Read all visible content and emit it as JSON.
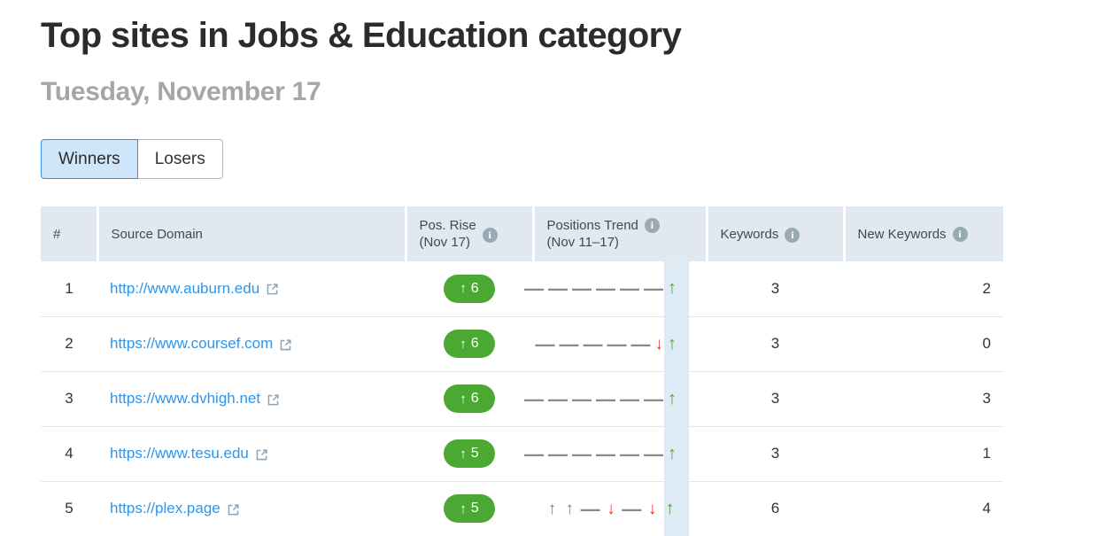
{
  "header": {
    "title": "Top sites in Jobs & Education category",
    "subtitle": "Tuesday, November 17"
  },
  "tabs": [
    {
      "label": "Winners",
      "active": true
    },
    {
      "label": "Losers",
      "active": false
    }
  ],
  "table": {
    "columns": [
      {
        "key": "rank",
        "label": "#",
        "sublabel": "",
        "info": false
      },
      {
        "key": "domain",
        "label": "Source Domain",
        "sublabel": "",
        "info": false
      },
      {
        "key": "rise",
        "label": "Pos. Rise",
        "sublabel": "(Nov 17)",
        "info": true
      },
      {
        "key": "trend",
        "label": "Positions Trend",
        "sublabel": "(Nov 11–17)",
        "info": true
      },
      {
        "key": "kw",
        "label": "Keywords",
        "sublabel": "",
        "info": true
      },
      {
        "key": "newkw",
        "label": "New Keywords",
        "sublabel": "",
        "info": true
      }
    ],
    "rows": [
      {
        "rank": "1",
        "domain": "http://www.auburn.edu",
        "rise_arrow": "↑",
        "rise_value": "6",
        "trend": [
          "flat",
          "flat",
          "flat",
          "flat",
          "flat",
          "flat",
          "up"
        ],
        "keywords": "3",
        "new_keywords": "2"
      },
      {
        "rank": "2",
        "domain": "https://www.coursef.com",
        "rise_arrow": "↑",
        "rise_value": "6",
        "trend": [
          "flat",
          "flat",
          "flat",
          "flat",
          "flat",
          "down",
          "up"
        ],
        "keywords": "3",
        "new_keywords": "0"
      },
      {
        "rank": "3",
        "domain": "https://www.dvhigh.net",
        "rise_arrow": "↑",
        "rise_value": "6",
        "trend": [
          "flat",
          "flat",
          "flat",
          "flat",
          "flat",
          "flat",
          "up"
        ],
        "keywords": "3",
        "new_keywords": "3"
      },
      {
        "rank": "4",
        "domain": "https://www.tesu.edu",
        "rise_arrow": "↑",
        "rise_value": "5",
        "trend": [
          "flat",
          "flat",
          "flat",
          "flat",
          "flat",
          "flat",
          "up"
        ],
        "keywords": "3",
        "new_keywords": "1"
      },
      {
        "rank": "5",
        "domain": "https://plex.page",
        "rise_arrow": "↑",
        "rise_value": "5",
        "trend": [
          "up",
          "up",
          "flat",
          "down",
          "flat",
          "down",
          "up"
        ],
        "keywords": "6",
        "new_keywords": "4"
      }
    ]
  },
  "glyphs": {
    "up": "↑",
    "down": "↓",
    "flat": "—",
    "info": "i"
  },
  "colors": {
    "link": "#2f95e8",
    "positive": "#4aa833",
    "negative": "#e8332a",
    "neutral": "#8a8a8a",
    "header_bg": "#e1e8ef",
    "tab_active_bg": "#cfe6fa",
    "tab_active_border": "#2f8fe0",
    "trend_highlight": "#dfeaf7"
  }
}
